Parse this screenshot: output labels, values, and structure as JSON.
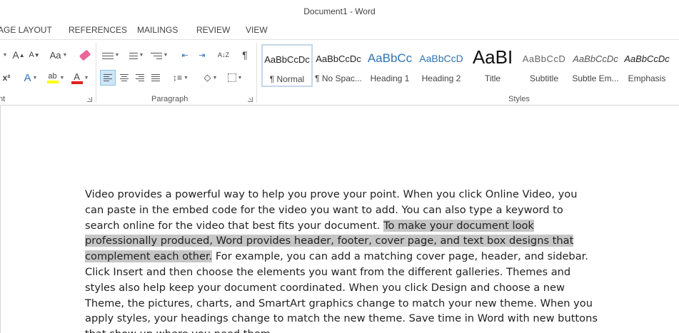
{
  "window": {
    "title": "Document1 - Word"
  },
  "tabs": [
    "AGE LAYOUT",
    "REFERENCES",
    "MAILINGS",
    "REVIEW",
    "VIEW"
  ],
  "ribbon": {
    "font_group_label": "nt",
    "paragraph_group_label": "Paragraph",
    "styles_group_label": "Styles",
    "font_buttons": {
      "grow": "A",
      "shrink": "A",
      "case": "Aa",
      "superscript": "x²",
      "text_effects": "A",
      "highlight": "ab",
      "font_color": "A"
    },
    "sort_glyph": "A↓Z",
    "pilcrow": "¶",
    "styles": [
      {
        "sample": "AaBbCcDc",
        "name": "¶ Normal",
        "selected": true
      },
      {
        "sample": "AaBbCcDc",
        "name": "¶ No Spac..."
      },
      {
        "sample": "AaBbCc",
        "name": "Heading 1"
      },
      {
        "sample": "AaBbCcD",
        "name": "Heading 2"
      },
      {
        "sample": "AaBI",
        "name": "Title"
      },
      {
        "sample": "AaBbCcD",
        "name": "Subtitle"
      },
      {
        "sample": "AaBbCcDc",
        "name": "Subtle Em..."
      },
      {
        "sample": "AaBbCcDc",
        "name": "Emphasis"
      }
    ]
  },
  "document": {
    "text_before": "Video provides a powerful way to help you prove your point. When you click Online Video, you can paste in the embed code for the video you want to add. You can also type a keyword to search online for the video that best fits your document. ",
    "text_selected": "To make your document look professionally produced, Word provides header, footer, cover page, and text box designs that complement each other.",
    "text_after": " For example, you can add a matching cover page, header, and sidebar. Click Insert and then choose the elements you want from the different galleries. Themes and styles also help keep your document coordinated. When you click Design and choose a new Theme, the pictures, charts, and SmartArt graphics change to match your new theme. When you apply styles, your headings change to match the new theme. Save time in Word with new buttons that show up where you need them."
  },
  "colors": {
    "highlight_yellow": "#ffff00",
    "font_red": "#e02020",
    "selection_gray": "#c6c6c6",
    "heading_blue": "#2e74b5"
  }
}
